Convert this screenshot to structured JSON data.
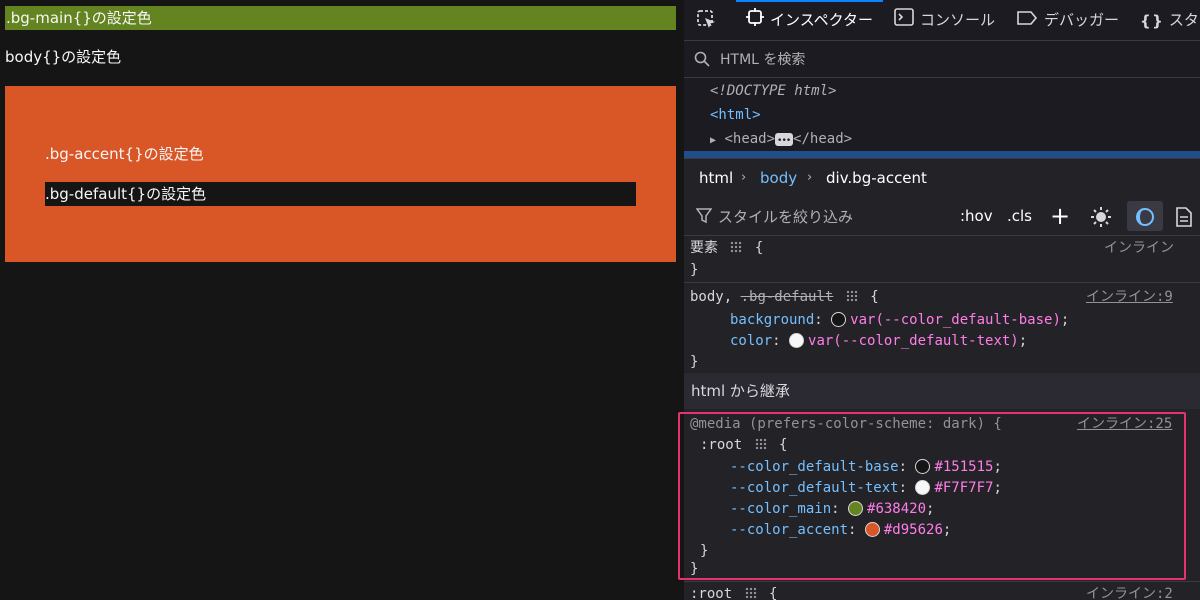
{
  "preview": {
    "bg_main_text": ".bg-main{}の設定色",
    "body_text": "body{}の設定色",
    "bg_accent_text": ".bg-accent{}の設定色",
    "bg_default_text": ".bg-default{}の設定色"
  },
  "toolbar": {
    "tabs": [
      {
        "label": "インスペクター",
        "icon": "inspector-icon"
      },
      {
        "label": "コンソール",
        "icon": "console-icon"
      },
      {
        "label": "デバッガー",
        "icon": "debugger-icon"
      },
      {
        "label": "スタ",
        "icon": "style-editor-icon"
      }
    ]
  },
  "search": {
    "placeholder": "HTML を検索"
  },
  "markup": {
    "doctype": "<!DOCTYPE html>",
    "html_open": "<html>",
    "head_open": "<head>",
    "head_close": "</head>"
  },
  "breadcrumbs": [
    "html",
    "body",
    "div.bg-accent"
  ],
  "filter": {
    "placeholder": "スタイルを絞り込み",
    "hov": ":hov",
    "cls": ".cls",
    "add": "+"
  },
  "rules": {
    "element": {
      "selector": "要素",
      "open": "{",
      "close": "}",
      "source": "インライン"
    },
    "body_rule": {
      "selector_active": "body,",
      "selector_inactive": ".bg-default",
      "open": "{",
      "close": "}",
      "source": "インライン:9",
      "declarations": [
        {
          "prop": "background",
          "value": "var(--color_default-base)",
          "swatch": "#151515"
        },
        {
          "prop": "color",
          "value": "var(--color_default-text)",
          "swatch": "#F7F7F7"
        }
      ]
    },
    "inherited_header": "html から継承",
    "media_rule": {
      "media": "@media (prefers-color-scheme: dark) {",
      "source": "インライン:25",
      "selector": ":root",
      "open": "{",
      "declarations": [
        {
          "prop": "--color_default-base",
          "value": "#151515",
          "swatch": "#151515"
        },
        {
          "prop": "--color_default-text",
          "value": "#F7F7F7",
          "swatch": "#F7F7F7"
        },
        {
          "prop": "--color_main",
          "value": "#638420",
          "swatch": "#638420"
        },
        {
          "prop": "--color_accent",
          "value": "#d95626",
          "swatch": "#d95626"
        }
      ],
      "close_inner": "}",
      "close_outer": "}"
    },
    "root_rule": {
      "selector": ":root",
      "open": "{",
      "source": "インライン:2"
    }
  },
  "colors": {
    "main": "#638420",
    "accent": "#d95626",
    "default_base": "#151515",
    "default_text": "#F7F7F7",
    "highlight_border": "#e8326d"
  }
}
